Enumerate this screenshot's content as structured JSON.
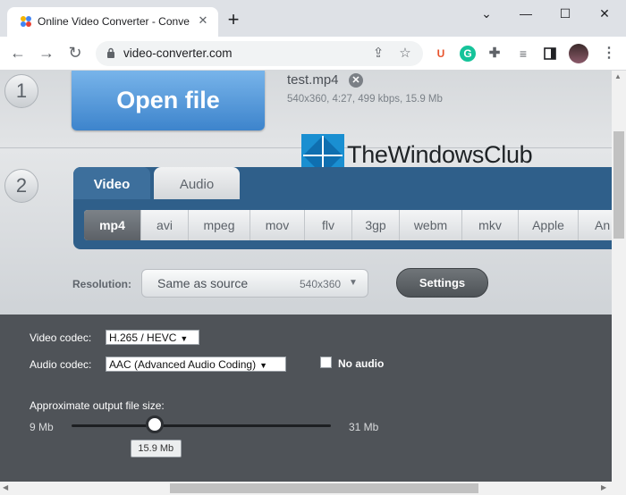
{
  "browser": {
    "tab_title": "Online Video Converter - Convert",
    "url": "video-converter.com",
    "new_tab": "+",
    "tab_close": "✕"
  },
  "page": {
    "step1": "1",
    "step2": "2",
    "open_file": "Open file",
    "file_name": "test.mp4",
    "file_meta": "540x360, 4:27, 499 kbps, 15.9 Mb",
    "watermark": "TheWindowsClub",
    "tabs": [
      "Video",
      "Audio"
    ],
    "formats": [
      "mp4",
      "avi",
      "mpeg",
      "mov",
      "flv",
      "3gp",
      "webm",
      "mkv",
      "Apple",
      "An"
    ],
    "active_format": "mp4",
    "resolution_label": "Resolution:",
    "resolution_value": "Same as source",
    "resolution_dim": "540x360",
    "settings": "Settings",
    "video_codec_label": "Video codec:",
    "video_codec": "H.265 / HEVC",
    "audio_codec_label": "Audio codec:",
    "audio_codec": "AAC (Advanced Audio Coding)",
    "no_audio": "No audio",
    "size_label": "Approximate output file size:",
    "size_min": "9 Mb",
    "size_max": "31 Mb",
    "size_value": "15.9 Mb",
    "size_fraction": 0.32
  },
  "colors": {
    "open_button": "#3d84cc",
    "tabs_panel": "#2f5f8a",
    "dark_panel": "#4f5358"
  }
}
